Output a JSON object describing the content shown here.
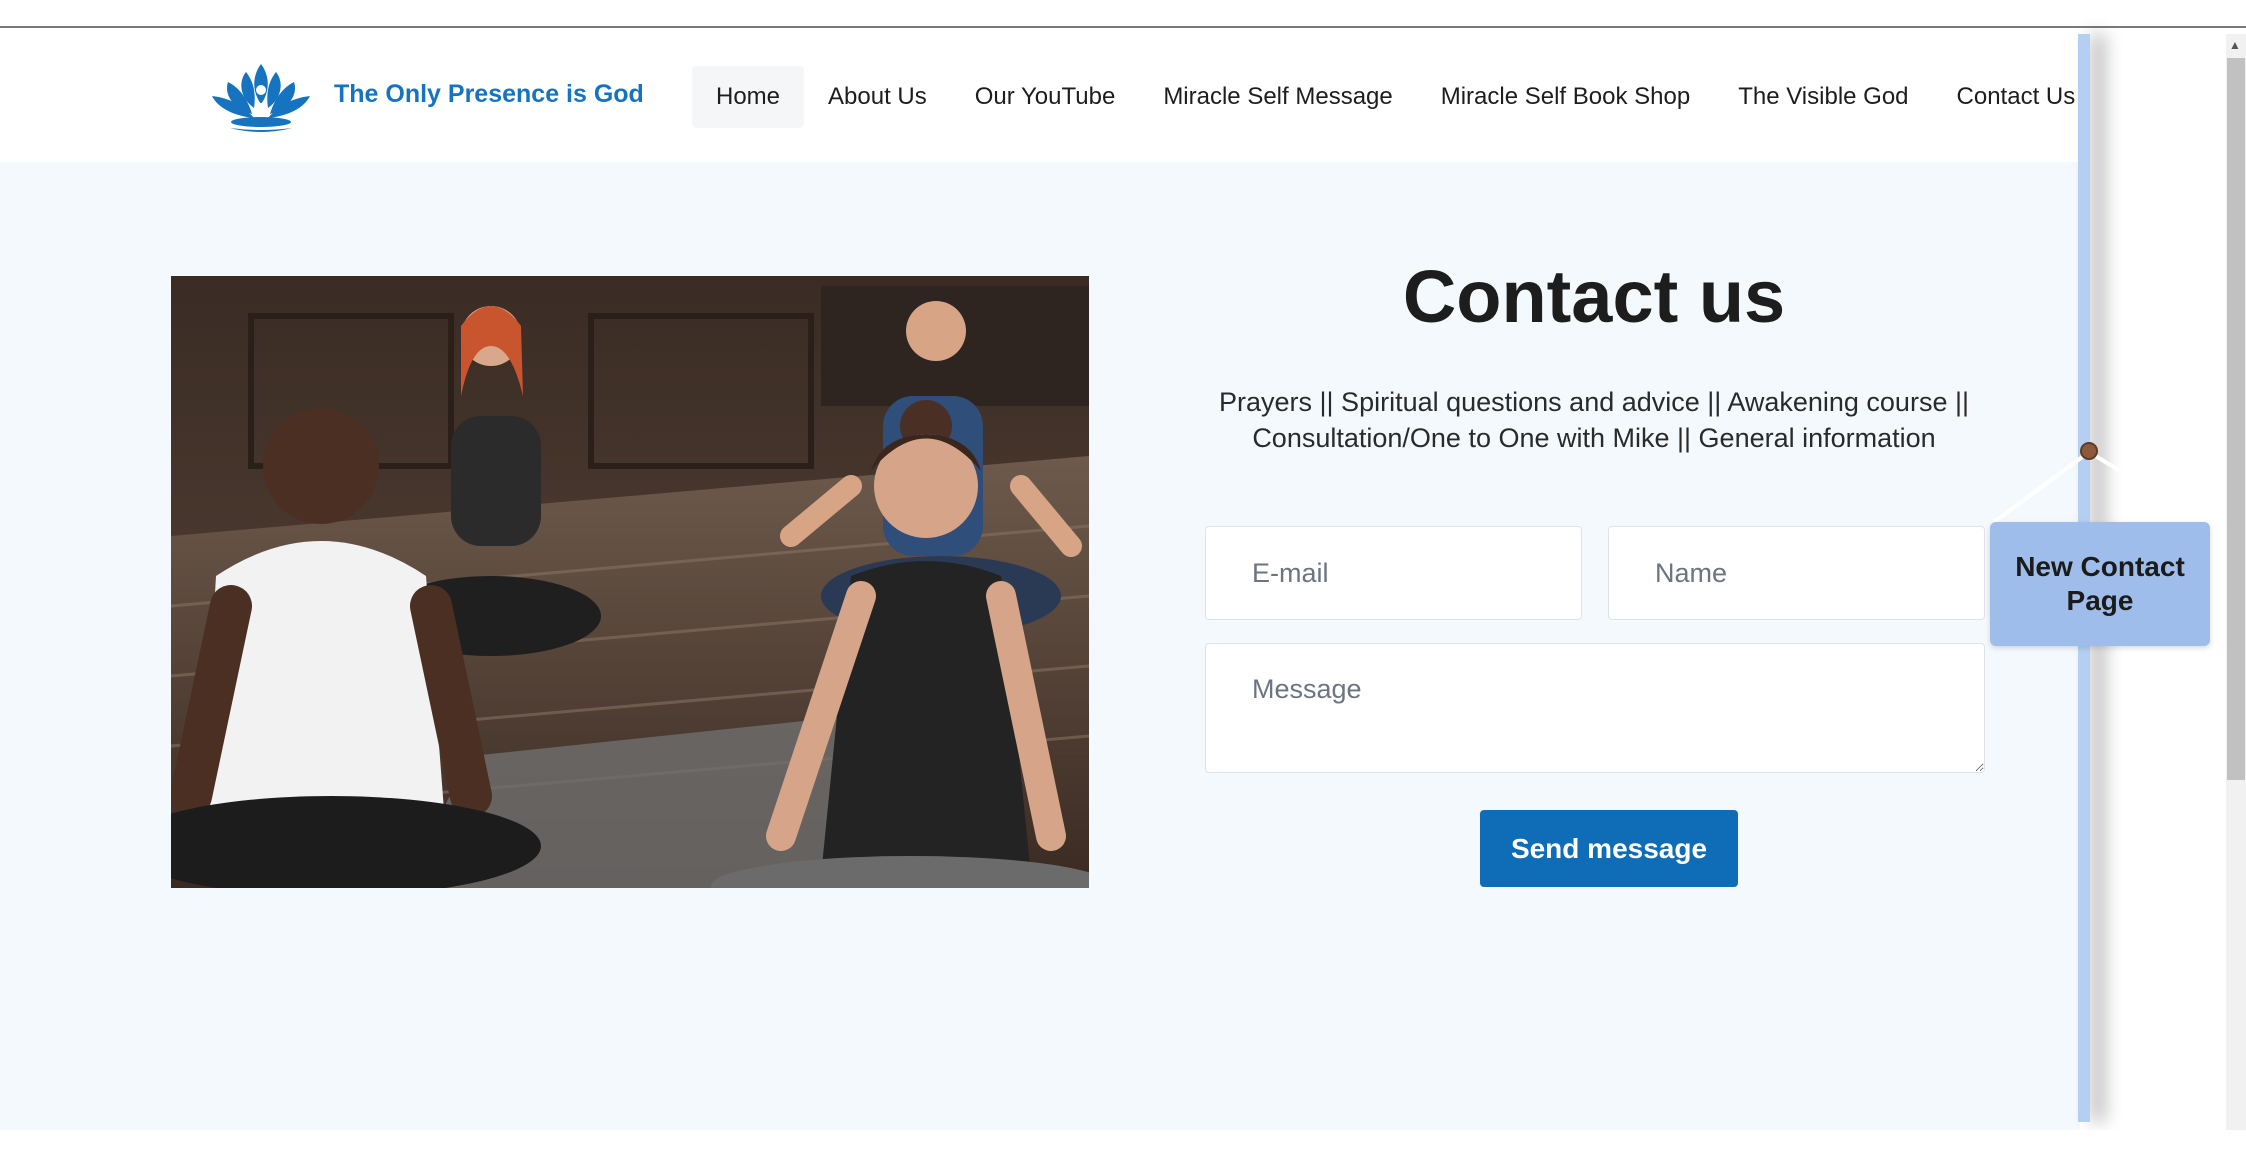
{
  "header": {
    "brand": "The Only Presence is God",
    "nav": [
      "Home",
      "About Us",
      "Our YouTube",
      "Miracle Self Message",
      "Miracle Self Book Shop",
      "The Visible God",
      "Contact Us"
    ]
  },
  "contact": {
    "title": "Contact us",
    "subtitle": "Prayers || Spiritual questions and advice || Awakening course || Consultation/One to One with Mike || General information",
    "email_placeholder": "E-mail",
    "name_placeholder": "Name",
    "message_placeholder": "Message",
    "send_label": "Send message"
  },
  "annotation": {
    "label": "New Contact Page"
  },
  "colors": {
    "brand": "#1673bf",
    "button": "#0f6db8",
    "page_bg": "#f4f9fd",
    "annotation": "#9fbdea"
  }
}
